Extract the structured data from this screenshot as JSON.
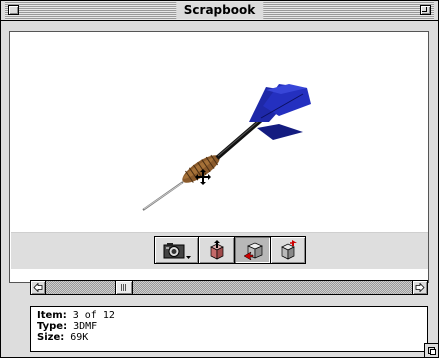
{
  "window": {
    "title": "Scrapbook"
  },
  "content": {
    "image_icon": "dart-3dmf-image",
    "tools": [
      {
        "icon": "camera-icon",
        "has_menu": true
      },
      {
        "icon": "rotate-object-icon"
      },
      {
        "icon": "move-object-icon",
        "pressed": true
      },
      {
        "icon": "reset-view-icon"
      }
    ]
  },
  "info": {
    "item_label": "Item:",
    "item_value": "3 of 12",
    "type_label": "Type:",
    "type_value": "3DMF",
    "size_label": "Size:",
    "size_value": "69K"
  },
  "scroll": {
    "position_fraction": 0.2
  },
  "colors": {
    "dart_flight": "#1e28a8",
    "dart_grip": "#8a5a2b",
    "dart_shaft": "#111111",
    "chrome": "#dddddd"
  }
}
